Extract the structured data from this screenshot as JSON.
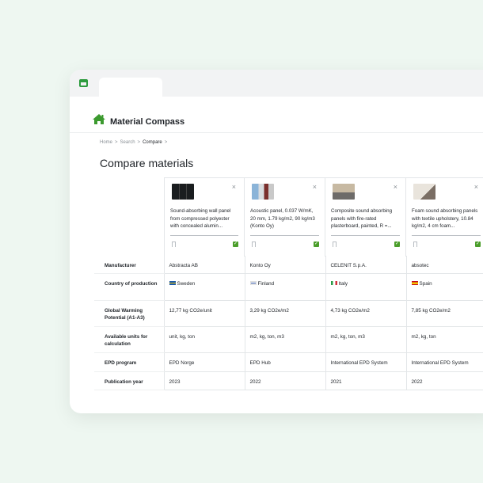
{
  "app": {
    "brand": "Material Compass",
    "accent_color": "#2e9b3f"
  },
  "breadcrumb": {
    "items": [
      "Home",
      "Search",
      "Compare"
    ],
    "separator": ">"
  },
  "page_title": "Compare materials",
  "products": [
    {
      "description": "Sound-absorbing wall panel from compressed polyester with concealed alumin...",
      "thumb_icon": "dark-panel-image"
    },
    {
      "description": "Acoustic panel, 0.037 W/mK, 20 mm, 1.79 kg/m2, 90 kg/m3 (Konto Oy)",
      "thumb_icon": "acoustic-panels-image"
    },
    {
      "description": "Composite sound absorbing panels with fire-rated plasterboard, painted, R =...",
      "thumb_icon": "room-interior-image"
    },
    {
      "description": "Foam sound absorbing panels with textile upholstery, 10.84 kg/m2, 4 cm foam...",
      "thumb_icon": "foam-panel-image"
    }
  ],
  "close_glyph": "×",
  "check_glyph": "✓",
  "rows": [
    {
      "label": "Manufacturer",
      "values": [
        "Abstracta AB",
        "Konto Oy",
        "CELENIT S.p.A.",
        "absotec"
      ]
    },
    {
      "label": "Country of production",
      "values": [
        "Sweden",
        "Finland",
        "Italy",
        "Spain"
      ]
    },
    {
      "label": "Global Warming Potential (A1-A3)",
      "values": [
        "12,77 kg CO2e/unit",
        "3,29 kg CO2e/m2",
        "4,73 kg CO2e/m2",
        "7,85 kg CO2e/m2"
      ]
    },
    {
      "label": "Available units for calculation",
      "values": [
        "unit, kg, ton",
        "m2, kg, ton, m3",
        "m2, kg, ton, m3",
        "m2, kg, ton"
      ]
    },
    {
      "label": "EPD program",
      "values": [
        "EPD Norge",
        "EPD Hub",
        "International EPD System",
        "International EPD System"
      ]
    },
    {
      "label": "Publication year",
      "values": [
        "2023",
        "2022",
        "2021",
        "2022"
      ]
    }
  ]
}
